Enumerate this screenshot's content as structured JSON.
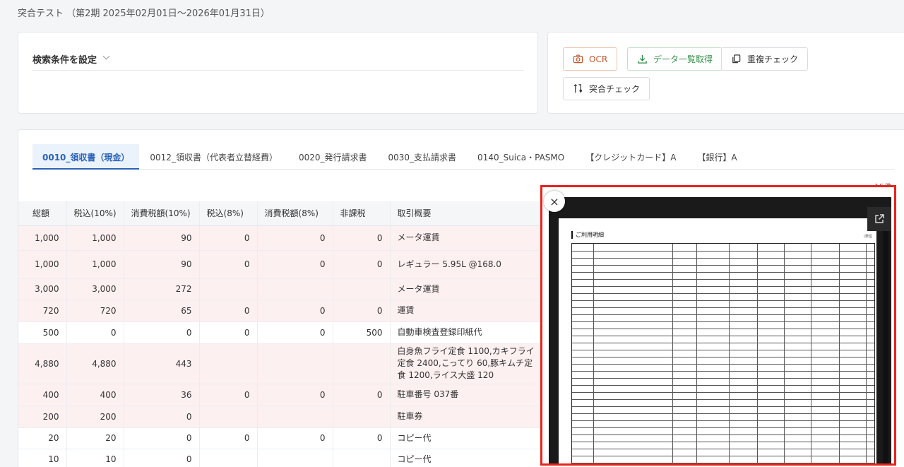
{
  "page": {
    "title": "突合テスト （第2期 2025年02月01日〜2026年01月31日）"
  },
  "search": {
    "label": "検索条件を設定"
  },
  "actions": {
    "ocr": "OCR",
    "data": "データ一覧取得",
    "dup": "重複チェック",
    "check": "突合チェック"
  },
  "tabs": [
    "0010_領収書（現金）",
    "0012_領収書（代表者立替経費）",
    "0020_発行請求書",
    "0030_支払請求書",
    "0140_Suica・PASMO",
    "【クレジットカード】A",
    "【銀行】A"
  ],
  "count_label": "15件",
  "table": {
    "headers": [
      "総額",
      "税込(10%)",
      "消費税額(10%)",
      "税込(8%)",
      "消費税額(8%)",
      "非課税",
      "取引概要"
    ],
    "rows": [
      [
        "1,000",
        "1,000",
        "90",
        "0",
        "0",
        "0",
        "メータ運賃"
      ],
      [
        "1,000",
        "1,000",
        "90",
        "0",
        "0",
        "0",
        "レギュラー 5.95L @168.0"
      ],
      [
        "3,000",
        "3,000",
        "272",
        "",
        "",
        "",
        "メータ運賃"
      ],
      [
        "720",
        "720",
        "65",
        "0",
        "0",
        "0",
        "運賃"
      ],
      [
        "500",
        "0",
        "0",
        "0",
        "0",
        "500",
        "自動車検査登録印紙代"
      ],
      [
        "4,880",
        "4,880",
        "443",
        "",
        "",
        "",
        "白身魚フライ定食 1100,カキフライ定食 2400,こってり 60,豚キムチ定食 1200,ライス大盛 120"
      ],
      [
        "400",
        "400",
        "36",
        "0",
        "0",
        "0",
        "駐車番号 037番"
      ],
      [
        "200",
        "200",
        "0",
        "",
        "",
        "",
        "駐車券"
      ],
      [
        "20",
        "20",
        "0",
        "0",
        "0",
        "0",
        "コピー代"
      ],
      [
        "10",
        "10",
        "0",
        "",
        "",
        "",
        "コピー代"
      ]
    ]
  },
  "viewer": {
    "doc_title": "ご利用明細",
    "doc_unit": "(単位",
    "close": "×"
  },
  "colors": {
    "accent": "#2a62b8",
    "highlight": "#e8231b",
    "row_pink": "#fdf0f1"
  }
}
